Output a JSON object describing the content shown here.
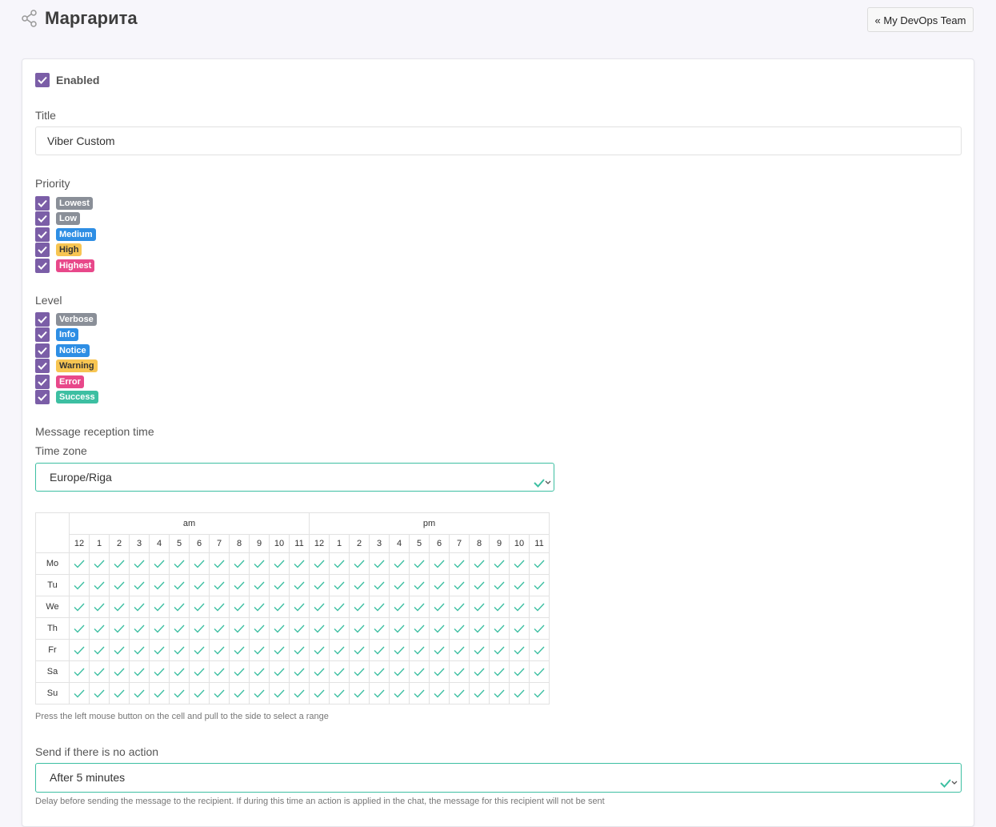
{
  "header": {
    "title": "Маргарита",
    "back_label": "« My DevOps Team",
    "icon": "share-icon"
  },
  "form": {
    "enabled_label": "Enabled",
    "enabled": true,
    "title_label": "Title",
    "title_value": "Viber Custom",
    "priority_label": "Priority",
    "priorities": [
      {
        "label": "Lowest",
        "color": "#8a8f98",
        "checked": true
      },
      {
        "label": "Low",
        "color": "#8a8f98",
        "checked": true
      },
      {
        "label": "Medium",
        "color": "#2e8ee4",
        "checked": true
      },
      {
        "label": "High",
        "color": "#f7c552",
        "checked": true
      },
      {
        "label": "Highest",
        "color": "#e8488a",
        "checked": true
      }
    ],
    "level_label": "Level",
    "levels": [
      {
        "label": "Verbose",
        "color": "#8a8f98",
        "checked": true
      },
      {
        "label": "Info",
        "color": "#2e8ee4",
        "checked": true
      },
      {
        "label": "Notice",
        "color": "#2e8ee4",
        "checked": true
      },
      {
        "label": "Warning",
        "color": "#f7c552",
        "checked": true
      },
      {
        "label": "Error",
        "color": "#e8488a",
        "checked": true
      },
      {
        "label": "Success",
        "color": "#3dbfa2",
        "checked": true
      }
    ],
    "reception_label": "Message reception time",
    "timezone_label": "Time zone",
    "timezone_value": "Europe/Riga",
    "schedule": {
      "am_label": "am",
      "pm_label": "pm",
      "hours": [
        "12",
        "1",
        "2",
        "3",
        "4",
        "5",
        "6",
        "7",
        "8",
        "9",
        "10",
        "11",
        "12",
        "1",
        "2",
        "3",
        "4",
        "5",
        "6",
        "7",
        "8",
        "9",
        "10",
        "11"
      ],
      "days": [
        "Mo",
        "Tu",
        "We",
        "Th",
        "Fr",
        "Sa",
        "Su"
      ],
      "all_selected": true
    },
    "schedule_hint": "Press the left mouse button on the cell and pull to the side to select a range",
    "no_action_label": "Send if there is no action",
    "no_action_value": "After 5 minutes",
    "no_action_hint": "Delay before sending the message to the recipient. If during this time an action is applied in the chat, the message for this recipient will not be sent"
  },
  "colors": {
    "checkbox": "#7b5ea7",
    "accent": "#3dbfa2"
  }
}
